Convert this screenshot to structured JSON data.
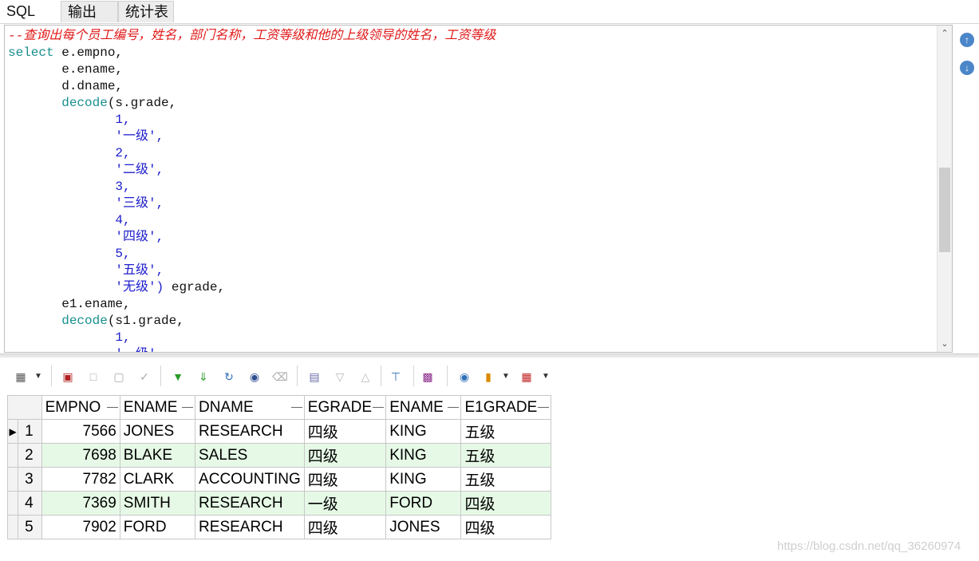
{
  "tabs": [
    {
      "label": "SQL"
    },
    {
      "label": "输出"
    },
    {
      "label": "统计表"
    }
  ],
  "editor": {
    "comment": "--查询出每个员工编号，姓名，部门名称，工资等级和他的上级领导的姓名，工资等级",
    "lines": [
      {
        "kw": "select",
        "rest": " e.empno,"
      },
      {
        "indent": "       ",
        "rest": "e.ename,"
      },
      {
        "indent": "       ",
        "rest": "d.dname,"
      },
      {
        "indent": "       ",
        "fn": "decode",
        "rest": "(s.grade,"
      },
      {
        "indent": "              ",
        "num": "1,"
      },
      {
        "indent": "              ",
        "str": "'一级',"
      },
      {
        "indent": "              ",
        "num": "2,"
      },
      {
        "indent": "              ",
        "str": "'二级',"
      },
      {
        "indent": "              ",
        "num": "3,"
      },
      {
        "indent": "              ",
        "str": "'三级',"
      },
      {
        "indent": "              ",
        "num": "4,"
      },
      {
        "indent": "              ",
        "str": "'四级',"
      },
      {
        "indent": "              ",
        "num": "5,"
      },
      {
        "indent": "              ",
        "str": "'五级',"
      },
      {
        "indent": "              ",
        "str": "'无级')",
        "rest": " egrade,"
      },
      {
        "indent": "       ",
        "rest": "e1.ename,"
      },
      {
        "indent": "       ",
        "fn": "decode",
        "rest": "(s1.grade,"
      },
      {
        "indent": "              ",
        "num": "1,"
      },
      {
        "indent": "              ",
        "str": "'一级',"
      }
    ]
  },
  "toolbar": {
    "icons": [
      "grid-options-icon",
      "lock-icon",
      "add-record-icon",
      "delete-record-icon",
      "post-changes-icon",
      "fetch-next-icon",
      "fetch-all-icon",
      "refresh-icon",
      "find-icon",
      "clear-icon",
      "single-record-icon",
      "sort-desc-icon",
      "sort-asc-icon",
      "query-by-example-icon",
      "save-icon",
      "export-icon",
      "chart-icon",
      "table-view-icon"
    ]
  },
  "grid": {
    "columns": [
      "EMPNO",
      "ENAME",
      "DNAME",
      "EGRADE",
      "ENAME",
      "E1GRADE"
    ],
    "rows": [
      {
        "n": "1",
        "empno": "7566",
        "ename": "JONES",
        "dname": "RESEARCH",
        "egrade": "四级",
        "mgr": "KING",
        "e1grade": "五级"
      },
      {
        "n": "2",
        "empno": "7698",
        "ename": "BLAKE",
        "dname": "SALES",
        "egrade": "四级",
        "mgr": "KING",
        "e1grade": "五级"
      },
      {
        "n": "3",
        "empno": "7782",
        "ename": "CLARK",
        "dname": "ACCOUNTING",
        "egrade": "四级",
        "mgr": "KING",
        "e1grade": "五级"
      },
      {
        "n": "4",
        "empno": "7369",
        "ename": "SMITH",
        "dname": "RESEARCH",
        "egrade": "一级",
        "mgr": "FORD",
        "e1grade": "四级"
      },
      {
        "n": "5",
        "empno": "7902",
        "ename": "FORD",
        "dname": "RESEARCH",
        "egrade": "四级",
        "mgr": "JONES",
        "e1grade": "四级"
      }
    ]
  },
  "watermark": "https://blog.csdn.net/qq_36260974",
  "colors": {
    "comment": "#e01a1a",
    "keyword": "#1a8f8f",
    "literal": "#1d1dcc",
    "alt_row": "#e6f9e6"
  }
}
